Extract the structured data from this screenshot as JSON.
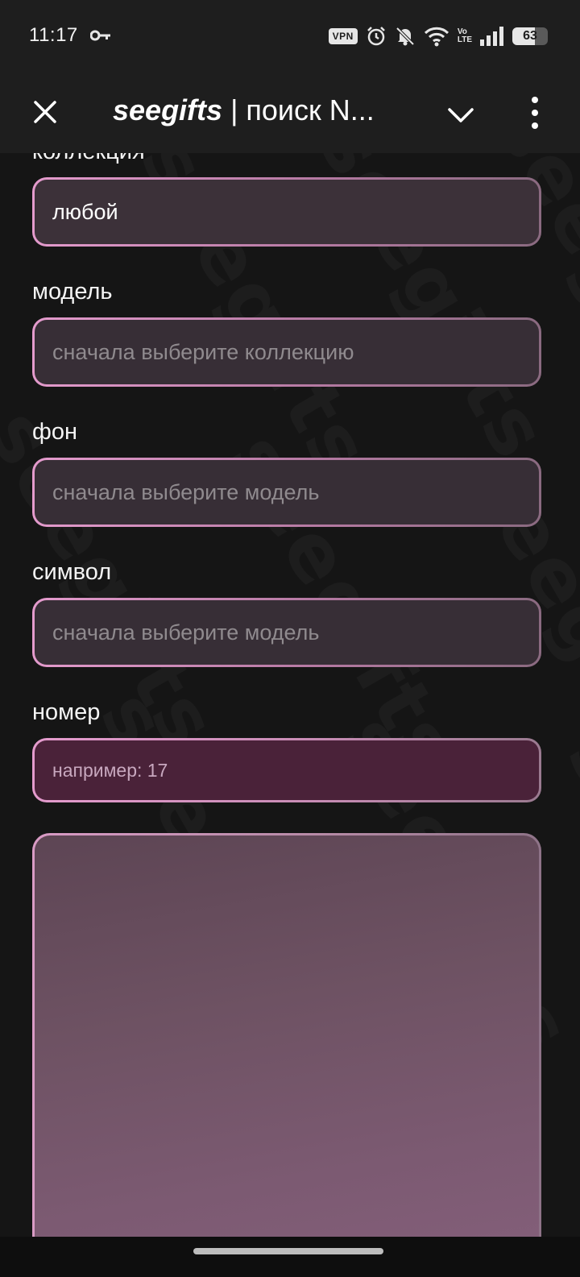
{
  "status_bar": {
    "time": "11:17",
    "vpn": "VPN",
    "volte_top": "Vo",
    "volte_bottom": "LTE",
    "battery": "63",
    "battery_level": 0.63
  },
  "app_bar": {
    "title_brand": "seegifts",
    "title_rest": " | поиск N..."
  },
  "watermark": "seegifts",
  "form": {
    "collection_label": "коллекция",
    "collection_value": "любой",
    "model_label": "модель",
    "model_placeholder": "сначала выберите коллекцию",
    "background_label": "фон",
    "background_placeholder": "сначала выберите модель",
    "symbol_label": "символ",
    "symbol_placeholder": "сначала выберите модель",
    "number_label": "номер",
    "number_placeholder": "например: 17"
  },
  "colors": {
    "accent_pink": "#e49bcd",
    "field_bg": "#372e36",
    "number_bg": "#4a2239",
    "background": "#151515"
  }
}
